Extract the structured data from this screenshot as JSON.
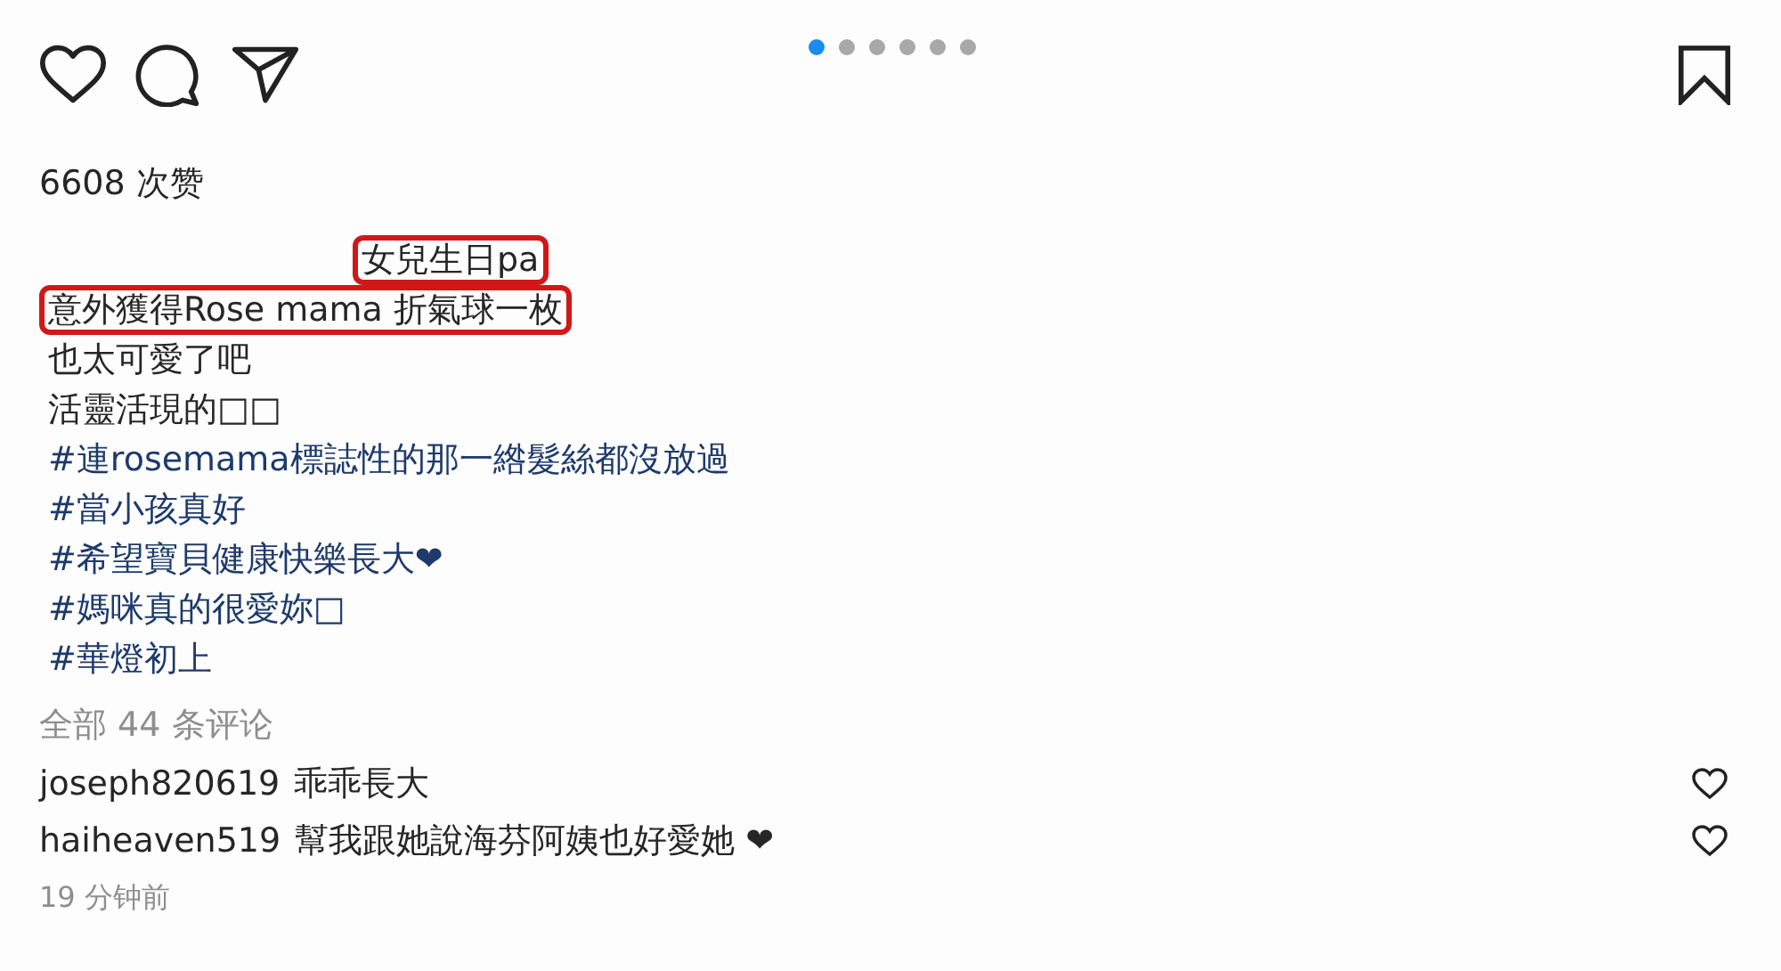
{
  "carousel_dots": [
    {
      "selected": true
    },
    {
      "selected": false
    },
    {
      "selected": false
    },
    {
      "selected": false
    },
    {
      "selected": false
    },
    {
      "selected": false
    }
  ],
  "likes": "6608 次赞",
  "caption": [
    {
      "kind": "lead",
      "text": "女兒生日pa",
      "highlighted": true
    },
    {
      "kind": "text",
      "text": "意外獲得Rose mama 折氣球一枚",
      "highlighted": true
    },
    {
      "kind": "text",
      "text": "也太可愛了吧",
      "highlighted": false
    },
    {
      "kind": "text",
      "text": "活靈活現的□□",
      "highlighted": false
    },
    {
      "kind": "hashtag",
      "text": "#連rosemama標誌性的那一綹髮絲都沒放過",
      "highlighted": false
    },
    {
      "kind": "hashtag",
      "text": "#當小孩真好",
      "highlighted": false
    },
    {
      "kind": "hashtag",
      "text": "#希望寶貝健康快樂長大❤",
      "highlighted": false
    },
    {
      "kind": "hashtag",
      "text": "#媽咪真的很愛妳□",
      "highlighted": false
    },
    {
      "kind": "hashtag",
      "text": "#華燈初上",
      "highlighted": false
    }
  ],
  "all_comments": "全部 44 条评论",
  "comments": [
    {
      "user": "joseph820619",
      "text": "乖乖長大"
    },
    {
      "user": "haiheaven519",
      "text": "幫我跟她說海芬阿姨也好愛她 ❤"
    }
  ],
  "time": "19 分钟前"
}
